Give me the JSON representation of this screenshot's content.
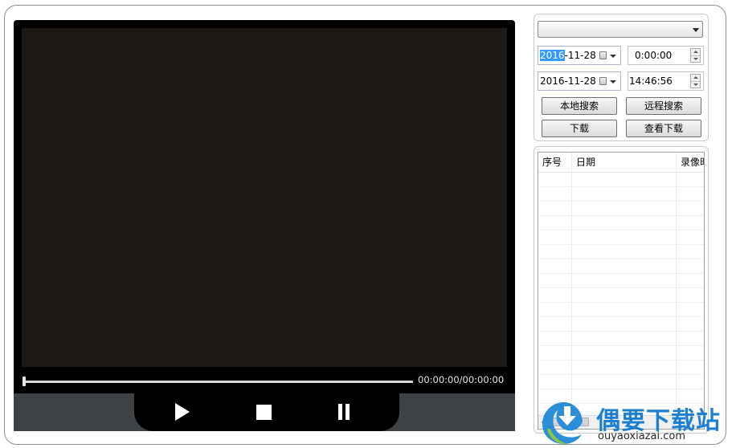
{
  "player": {
    "time_display": "00:00:00/00:00:00",
    "progress": 0
  },
  "controls": {
    "play_icon": "play-icon",
    "stop_icon": "stop-icon",
    "pause_icon": "pause-icon"
  },
  "search": {
    "channel_value": "",
    "start_date_selected": "2016",
    "start_date_rest": "-11-28",
    "start_time": "0:00:00",
    "end_date": "2016-11-28",
    "end_time": "14:46:56",
    "buttons": {
      "local_search": "本地搜索",
      "remote_search": "远程搜索",
      "download": "下载",
      "view_downloads": "查看下载"
    }
  },
  "results": {
    "columns": [
      "序号",
      "日期",
      "录像时"
    ],
    "rows": []
  },
  "watermark": {
    "name": "偶要下载站",
    "url": "ouyaoxiazai.com"
  },
  "colors": {
    "video_background": "#1c1917",
    "control_bar": "#3f4245",
    "selection_highlight": "#3399ff",
    "logo_blue": "#1c7fd0"
  }
}
